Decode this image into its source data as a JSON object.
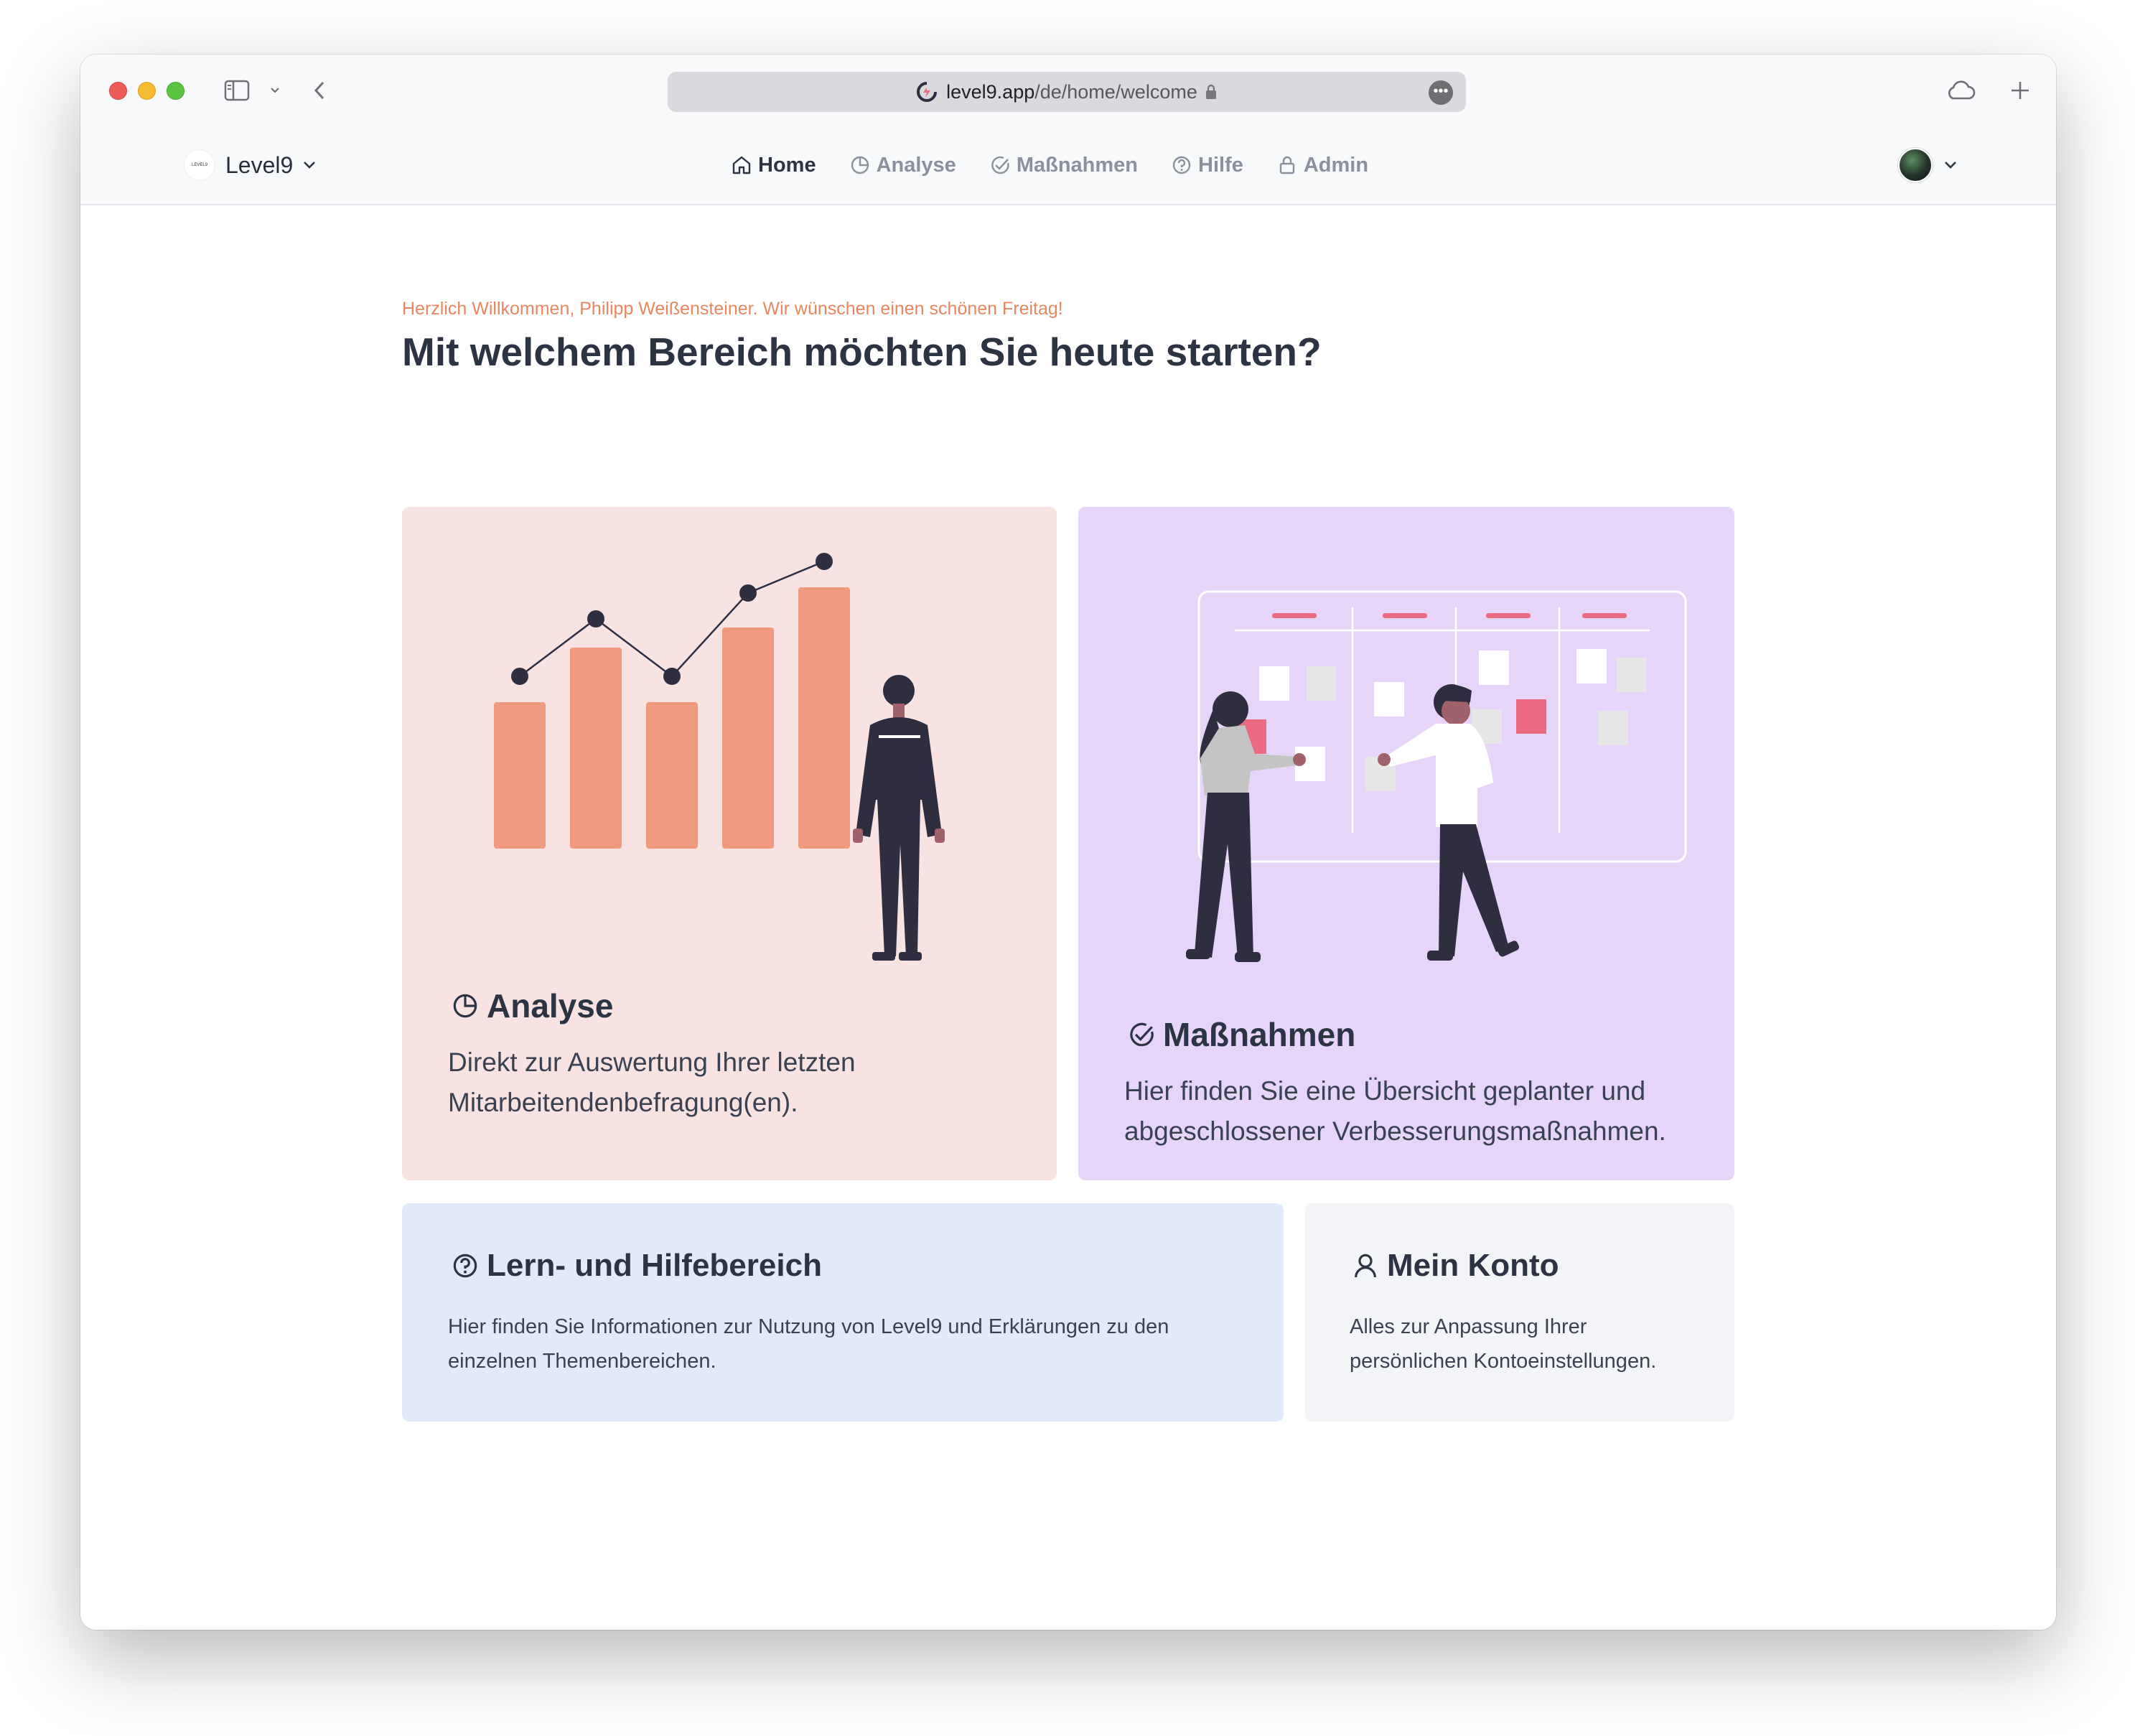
{
  "browser": {
    "url_domain": "level9.app",
    "url_path": "/de/home/welcome"
  },
  "nav": {
    "brand_name": "Level9",
    "brand_logo_text": "LEVEL9",
    "items": [
      {
        "label": "Home",
        "icon": "home-icon",
        "active": true
      },
      {
        "label": "Analyse",
        "icon": "pie-chart-icon",
        "active": false
      },
      {
        "label": "Maßnahmen",
        "icon": "check-circle-icon",
        "active": false
      },
      {
        "label": "Hilfe",
        "icon": "question-circle-icon",
        "active": false
      },
      {
        "label": "Admin",
        "icon": "lock-icon",
        "active": false
      }
    ]
  },
  "main": {
    "greeting": "Herzlich Willkommen, Philipp Weißensteiner. Wir wünschen einen schönen Freitag!",
    "headline": "Mit welchem Bereich möchten Sie heute starten?",
    "cards": {
      "analyse": {
        "title": "Analyse",
        "desc_line1": "Direkt zur Auswertung Ihrer letzten",
        "desc_line2": "Mitarbeitendenbefragung(en).",
        "icon": "pie-chart-icon",
        "bg": "#f8e2e2"
      },
      "massnahmen": {
        "title": "Maßnahmen",
        "desc_line1": "Hier finden Sie eine Übersicht geplanter und",
        "desc_line2": "abgeschlossener Verbesserungsmaßnahmen.",
        "icon": "check-circle-icon",
        "bg": "#e6d5f8"
      },
      "lern": {
        "title": "Lern- und Hilfebereich",
        "desc_line1": "Hier finden Sie Informationen zur Nutzung von Level9 und Erklärungen zu den",
        "desc_line2": "einzelnen Themenbereichen.",
        "icon": "question-circle-icon",
        "bg": "#e1eafa"
      },
      "konto": {
        "title": "Mein Konto",
        "desc_line1": "Alles zur Anpassung Ihrer",
        "desc_line2": "persönlichen Kontoeinstellungen.",
        "icon": "user-icon",
        "bg": "#f2f4f8"
      }
    }
  },
  "colors": {
    "accent": "#e8875f",
    "bar": "#f0997e",
    "dark": "#2f2e41",
    "pink": "#ea6b82",
    "heading": "#2c3444"
  }
}
